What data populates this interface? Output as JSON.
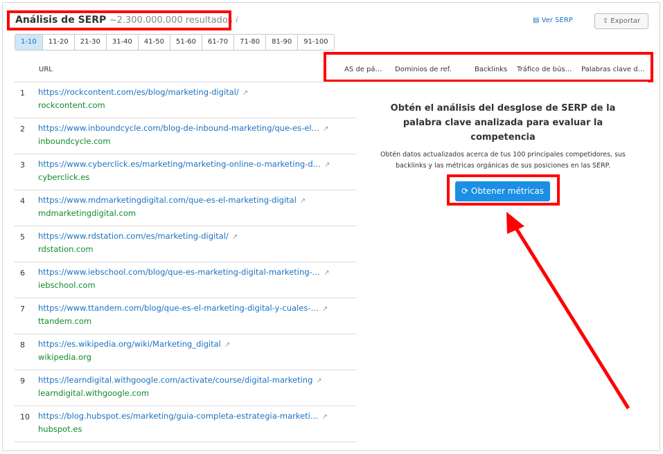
{
  "header": {
    "title": "Análisis de SERP",
    "results": "~2.300.000.000 resultados",
    "info_icon": "i",
    "view_serp": "Ver SERP",
    "export": "Exportar"
  },
  "pages": [
    "1-10",
    "11-20",
    "21-30",
    "31-40",
    "41-50",
    "51-60",
    "61-70",
    "71-80",
    "81-90",
    "91-100"
  ],
  "columns": {
    "url": "URL",
    "as": "AS de pá…",
    "ref": "Dominios de ref.",
    "backlinks": "Backlinks",
    "traffic": "Tráfico de bús…",
    "keywords": "Palabras clave d…"
  },
  "rows": [
    {
      "n": "1",
      "url": "https://rockcontent.com/es/blog/marketing-digital/",
      "domain": "rockcontent.com"
    },
    {
      "n": "2",
      "url": "https://www.inboundcycle.com/blog-de-inbound-marketing/que-es-el…",
      "domain": "inboundcycle.com"
    },
    {
      "n": "3",
      "url": "https://www.cyberclick.es/marketing/marketing-online-o-marketing-d…",
      "domain": "cyberclick.es"
    },
    {
      "n": "4",
      "url": "https://www.mdmarketingdigital.com/que-es-el-marketing-digital",
      "domain": "mdmarketingdigital.com"
    },
    {
      "n": "5",
      "url": "https://www.rdstation.com/es/marketing-digital/",
      "domain": "rdstation.com"
    },
    {
      "n": "6",
      "url": "https://www.iebschool.com/blog/que-es-marketing-digital-marketing-…",
      "domain": "iebschool.com"
    },
    {
      "n": "7",
      "url": "https://www.ttandem.com/blog/que-es-el-marketing-digital-y-cuales-…",
      "domain": "ttandem.com"
    },
    {
      "n": "8",
      "url": "https://es.wikipedia.org/wiki/Marketing_digital",
      "domain": "wikipedia.org"
    },
    {
      "n": "9",
      "url": "https://learndigital.withgoogle.com/activate/course/digital-marketing",
      "domain": "learndigital.withgoogle.com"
    },
    {
      "n": "10",
      "url": "https://blog.hubspot.es/marketing/guia-completa-estrategia-marketi…",
      "domain": "hubspot.es"
    }
  ],
  "overlay": {
    "heading": "Obtén el análisis del desglose de SERP de la palabra clave analizada para evaluar la competencia",
    "text": "Obtén datos actualizados acerca de tus 100 principales competidores, sus backlinks y las métricas orgánicas de sus posiciones en las SERP.",
    "button": "Obtener métricas"
  },
  "colors": {
    "link": "#1a72c2",
    "domain": "#108b2c",
    "accent": "#1a8fe3",
    "annotation": "#ff0000"
  }
}
